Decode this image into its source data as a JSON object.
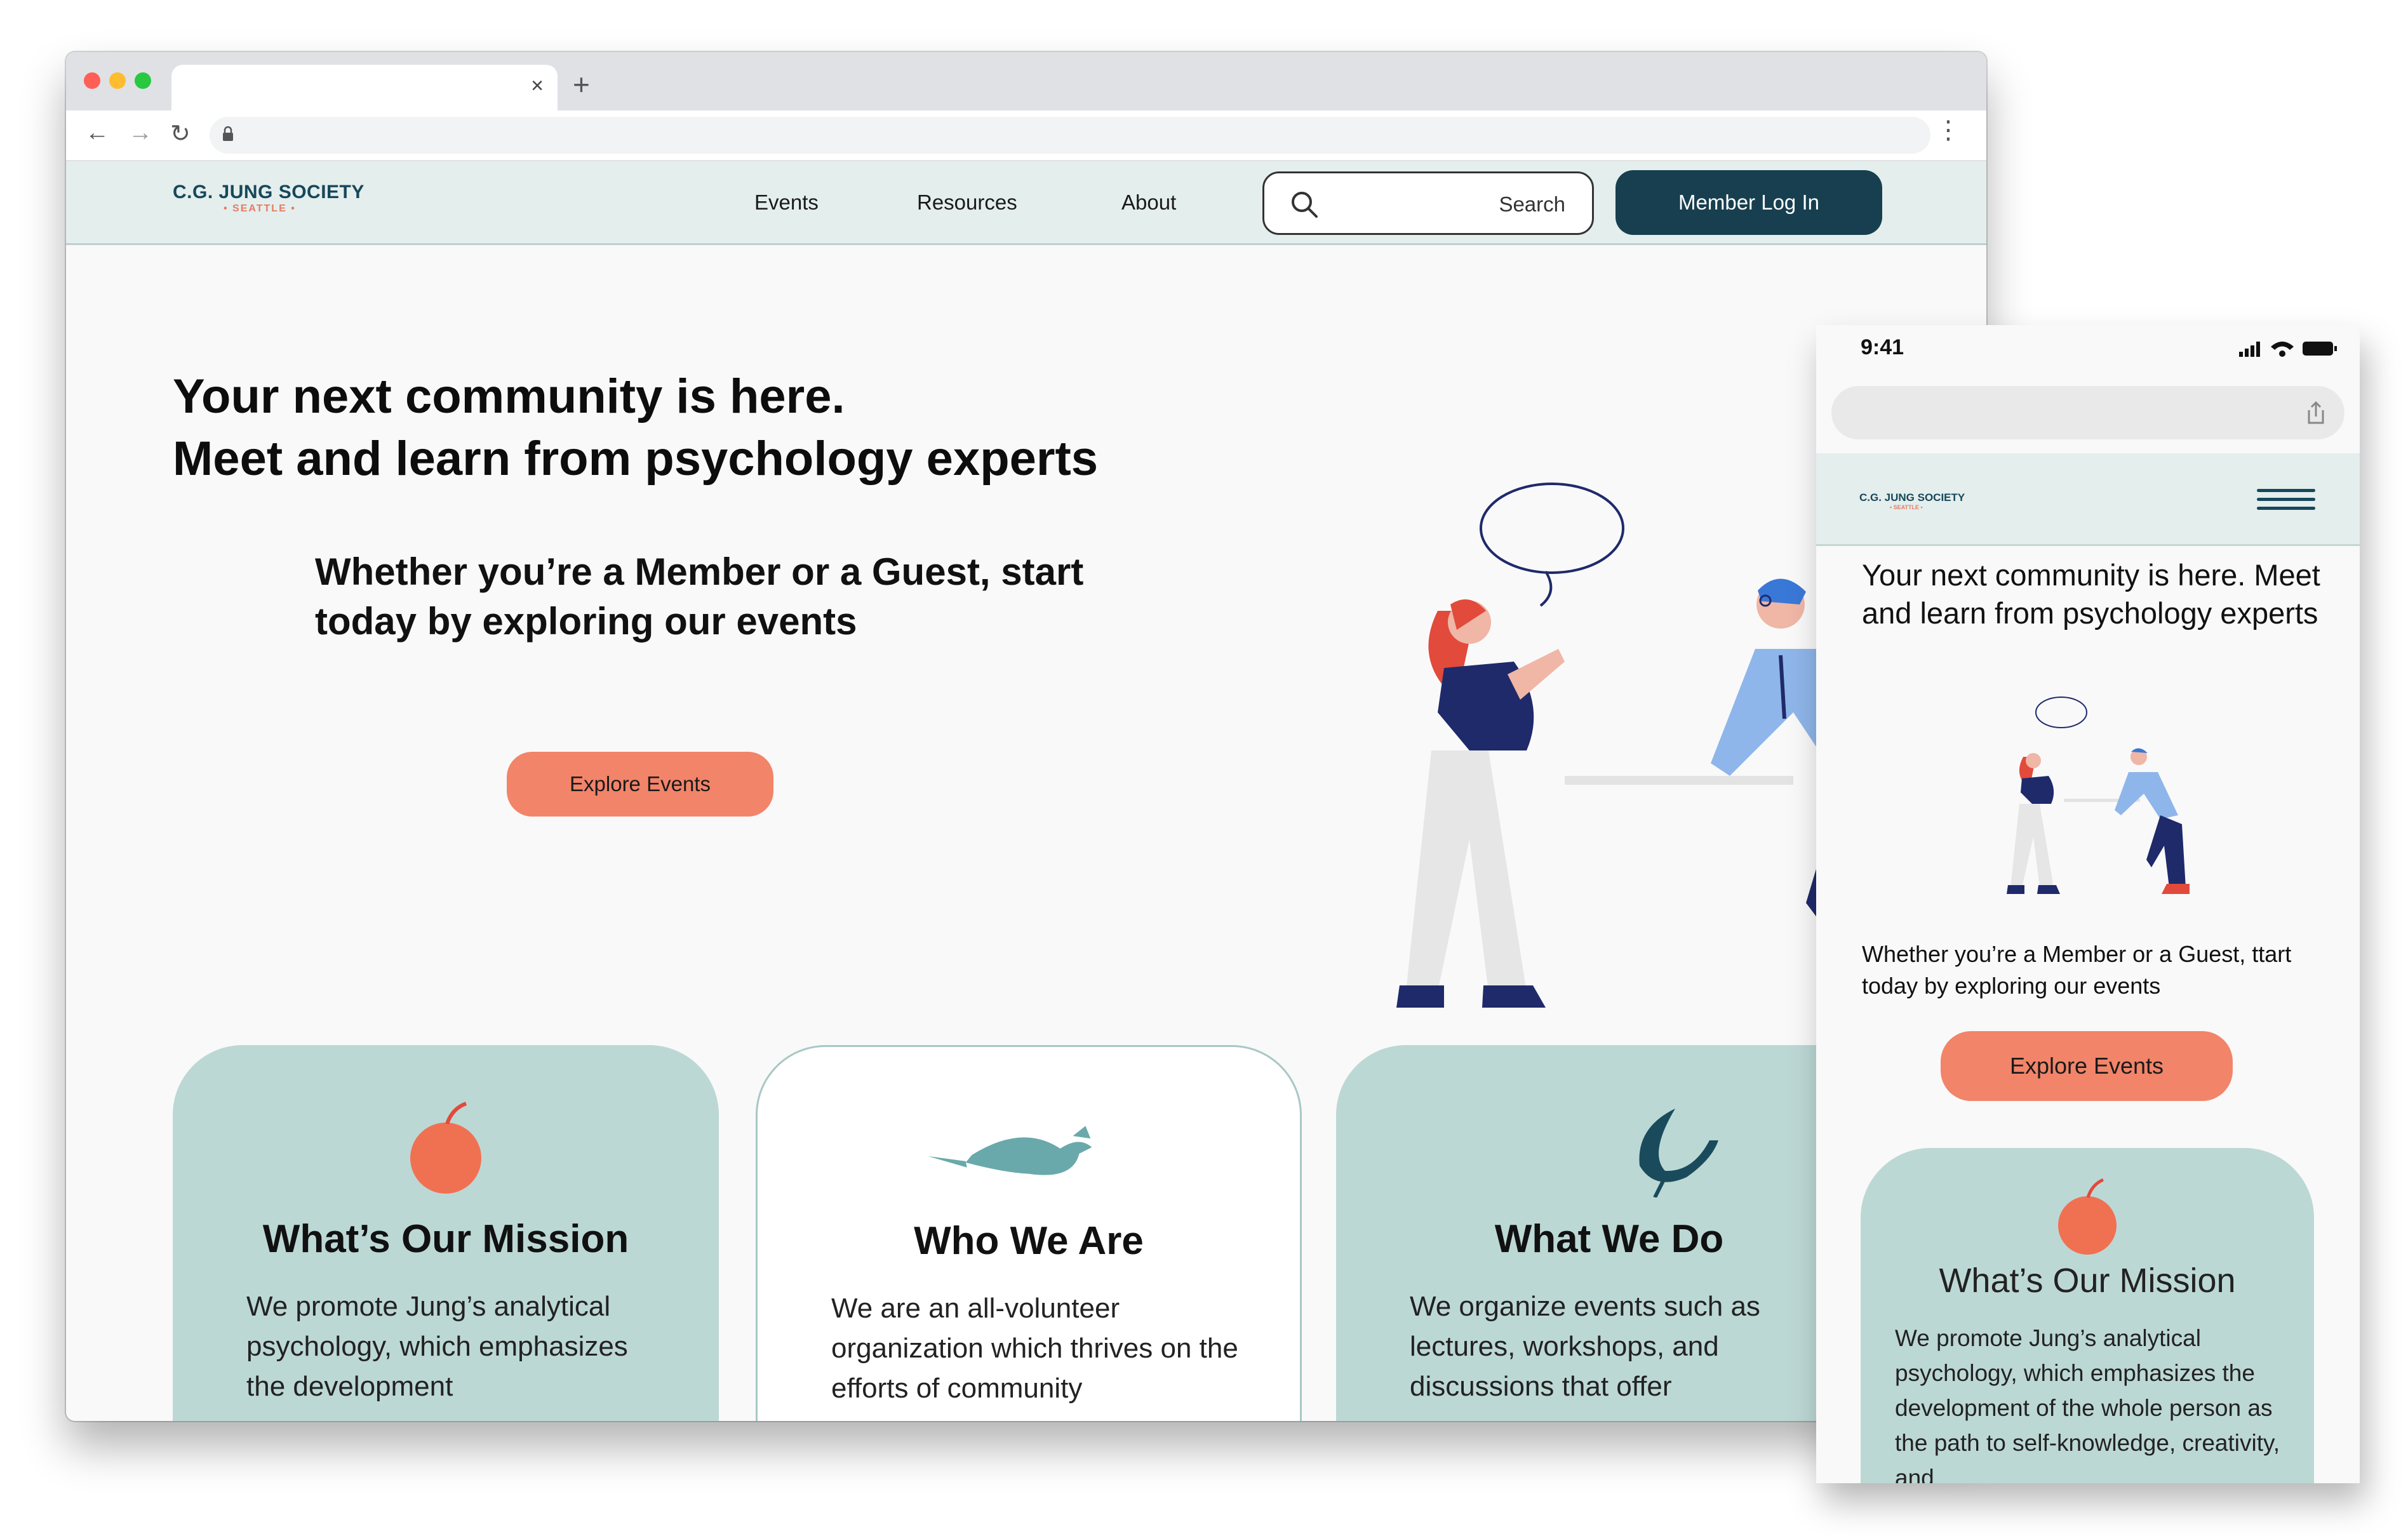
{
  "brand": {
    "name": "C.G. JUNG SOCIETY",
    "city": "• SEATTLE •"
  },
  "desktop": {
    "nav": [
      "Events",
      "Resources",
      "About"
    ],
    "search": {
      "label": "Search"
    },
    "login": "Member Log In",
    "hero": {
      "line1": "Your next community is here.",
      "line2": "Meet and learn from psychology experts",
      "sub": "Whether you’re a Member or a Guest, start today by exploring our events",
      "cta": "Explore Events"
    },
    "cards": [
      {
        "title": "What’s Our Mission",
        "body": "We promote Jung’s analytical psychology, which emphasizes the development",
        "icon": "apple-icon"
      },
      {
        "title": "Who We Are",
        "body": "We are an all-volunteer organization which thrives on the efforts of community",
        "icon": "bird-icon"
      },
      {
        "title": "What We Do",
        "body": "We organize events such as lectures, workshops, and discussions that offer",
        "icon": "leaf-icon"
      }
    ]
  },
  "mobile": {
    "time": "9:41",
    "hero": "Your next community is here. Meet and learn from psychology experts",
    "sub": "Whether you’re a Member or a Guest, ttart today by exploring our events",
    "cta": "Explore Events",
    "card": {
      "title": "What’s Our Mission",
      "body": "We promote Jung’s analytical psychology, which emphasizes the development of the whole person as the path to self-knowledge, creativity, and"
    }
  },
  "colors": {
    "header_bg": "#e4eeed",
    "card_teal": "#bcd8d5",
    "accent_coral": "#f28469",
    "brand_navy": "#173f4f"
  }
}
